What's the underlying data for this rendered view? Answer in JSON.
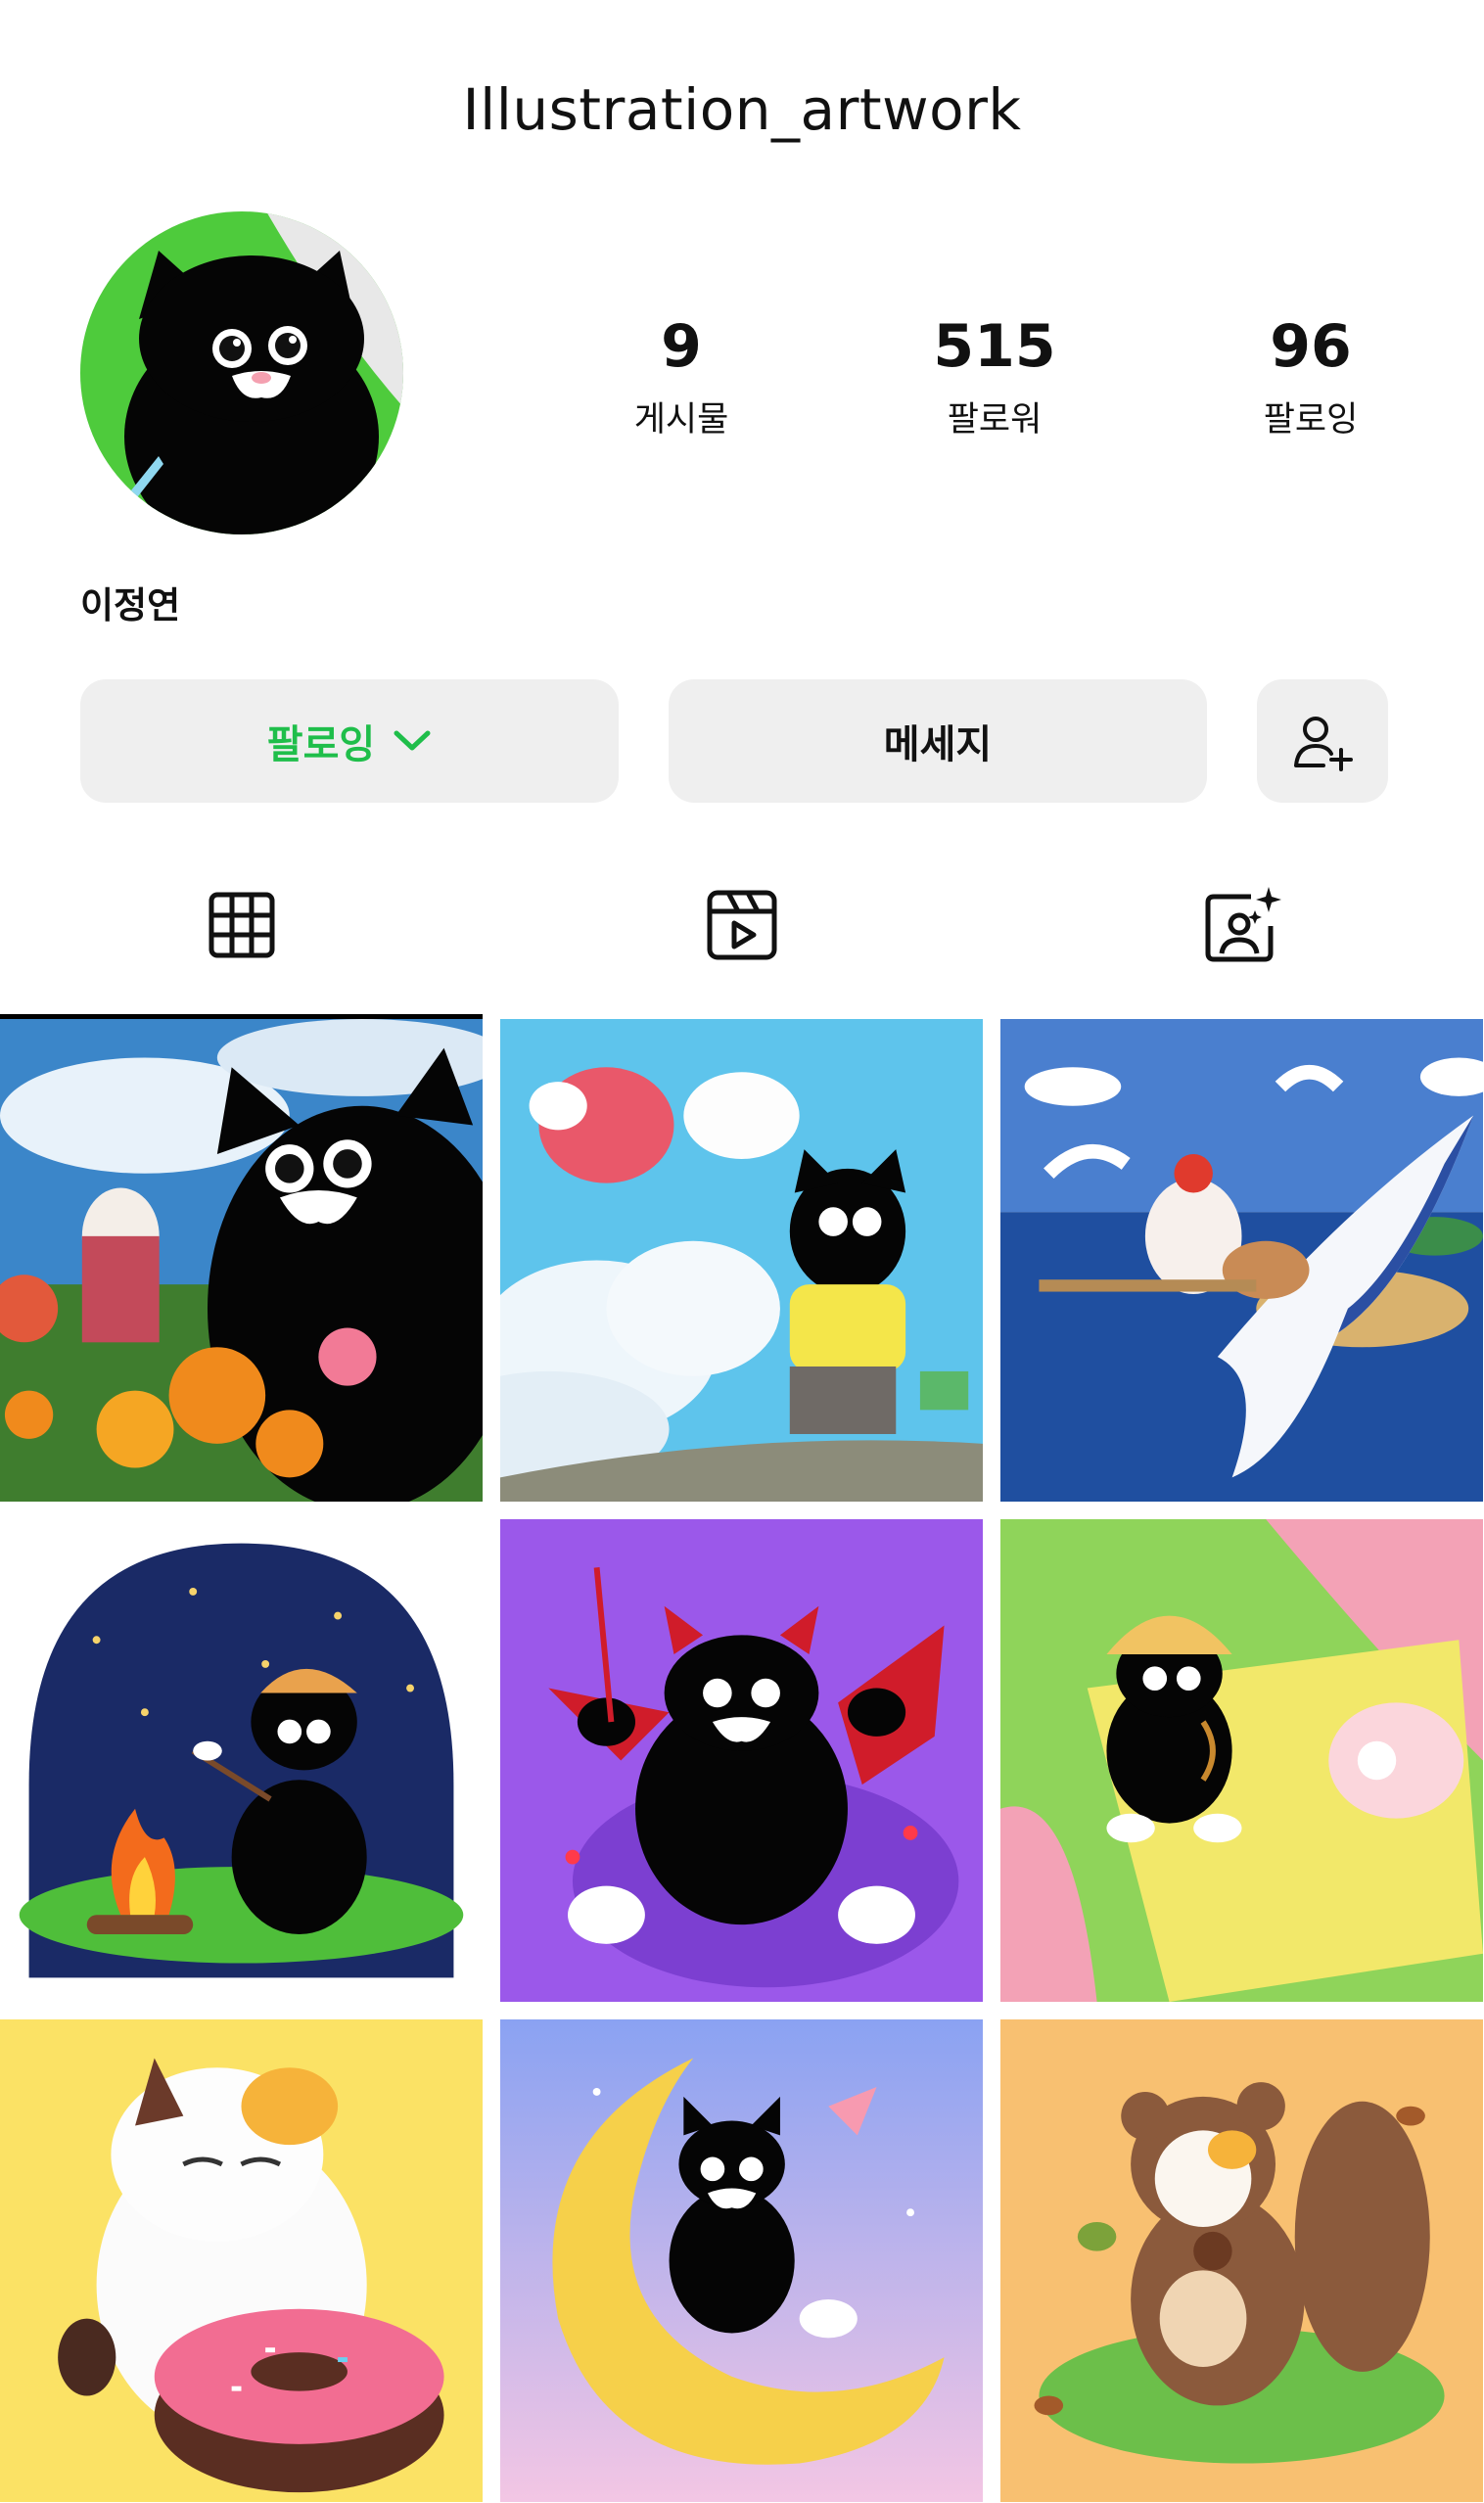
{
  "header": {
    "username": "Illustration_artwork"
  },
  "profile": {
    "name": "이정연",
    "stats": [
      {
        "value": "9",
        "label": "게시물"
      },
      {
        "value": "515",
        "label": "팔로워"
      },
      {
        "value": "96",
        "label": "팔로잉"
      }
    ]
  },
  "actions": {
    "follow_label": "팔로잉",
    "message_label": "메세지"
  },
  "tabs": [
    {
      "icon": "grid-icon",
      "selected": true
    },
    {
      "icon": "reels-icon",
      "selected": false
    },
    {
      "icon": "tagged-icon",
      "selected": false
    }
  ],
  "colors": {
    "follow_accent": "#1fbe4a",
    "button_bg": "#efefef"
  },
  "posts": [
    {
      "icon": "cat-in-flowers-illustration"
    },
    {
      "icon": "cat-sky-illustration"
    },
    {
      "icon": "cat-seagull-sea-illustration"
    },
    {
      "icon": "cat-campfire-night-illustration"
    },
    {
      "icon": "devil-cat-illustration"
    },
    {
      "icon": "cat-picnic-illustration"
    },
    {
      "icon": "cat-donut-illustration"
    },
    {
      "icon": "cat-moon-illustration"
    },
    {
      "icon": "cat-squirrel-autumn-illustration"
    }
  ]
}
